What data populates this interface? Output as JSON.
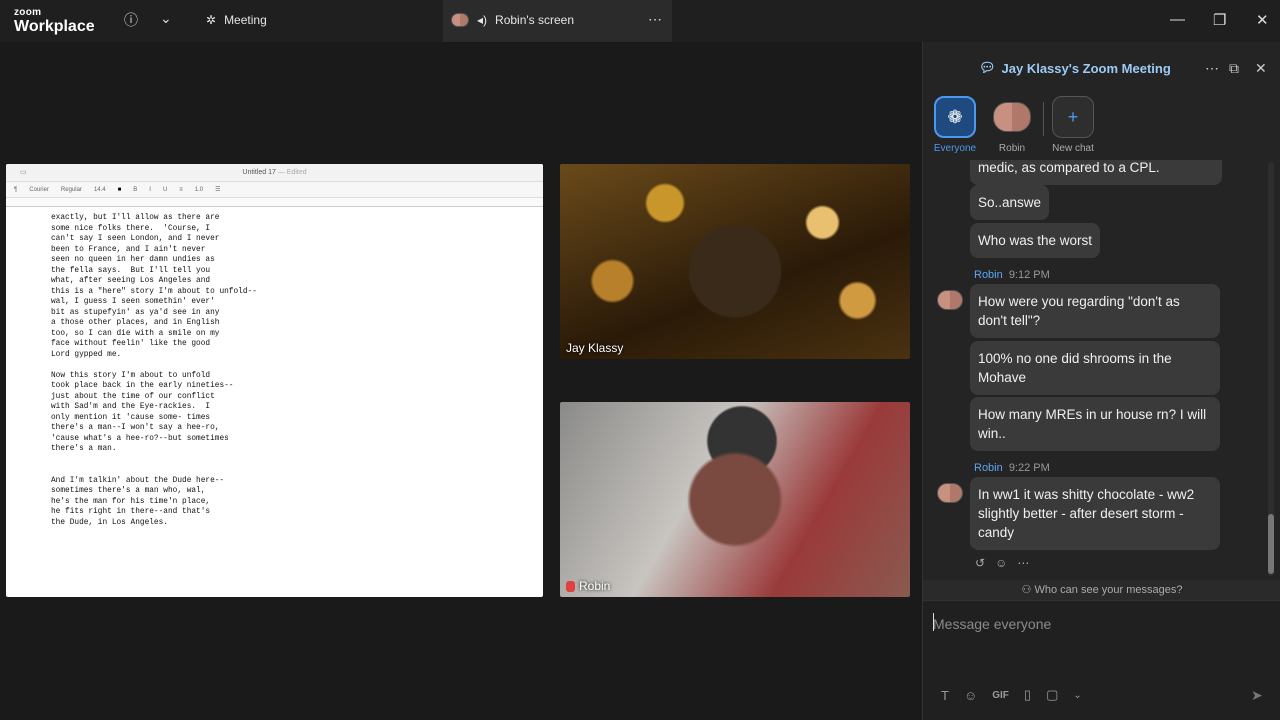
{
  "titlebar": {
    "logo_top": "zoom",
    "logo_bottom": "Workplace",
    "meeting_label": "Meeting",
    "screen_label": "Robin's screen"
  },
  "document": {
    "title": "Untitled 17",
    "title_sub": "— Edited",
    "font_name": "Courier",
    "font_style": "Regular",
    "font_size": "14.4",
    "line_spacing": "1.0",
    "text": "exactly, but I'll allow as there are\nsome nice folks there.  'Course, I\ncan't say I seen London, and I never\nbeen to France, and I ain't never\nseen no queen in her damn undies as\nthe fella says.  But I'll tell you\nwhat, after seeing Los Angeles and\nthis is a \"here\" story I'm about to unfold--\nwal, I guess I seen somethin' ever'\nbit as stupefyin' as ya'd see in any\na those other places, and in English\ntoo, so I can die with a smile on my\nface without feelin' like the good\nLord gypped me.\n\nNow this story I'm about to unfold\ntook place back in the early nineties--\njust about the time of our conflict\nwith Sad'm and the Eye-rackies.  I\nonly mention it 'cause some- times\nthere's a man--I won't say a hee-ro,\n'cause what's a hee-ro?--but sometimes\nthere's a man.\n\n\nAnd I'm talkin' about the Dude here--\nsometimes there's a man who, wal,\nhe's the man for his time'n place,\nhe fits right in there--and that's\nthe Dude, in Los Angeles."
  },
  "videos": {
    "top_name": "Jay Klassy",
    "bottom_name": "Robin"
  },
  "chat": {
    "title": "Jay Klassy's Zoom Meeting",
    "tabs": [
      {
        "label": "Everyone"
      },
      {
        "label": "Robin"
      },
      {
        "label": "New chat"
      }
    ],
    "messages": [
      {
        "text": "medic, as compared to a CPL."
      },
      {
        "text": "So..answe"
      },
      {
        "text": "Who was the worst"
      },
      {
        "sender": "Robin",
        "time": "9:12 PM",
        "text": "How were you regarding \"don't as don't tell\"?"
      },
      {
        "text": "100% no one did shrooms in the Mohave"
      },
      {
        "text": "How many MREs in ur house rn? I will win.."
      },
      {
        "sender": "Robin",
        "time": "9:22 PM",
        "text": "In ww1 it was shitty chocolate - ww2 slightly better -  after desert storm - candy"
      }
    ],
    "who_can_see": "Who can see your messages?",
    "input_placeholder": "Message everyone",
    "gif_label": "GIF"
  }
}
